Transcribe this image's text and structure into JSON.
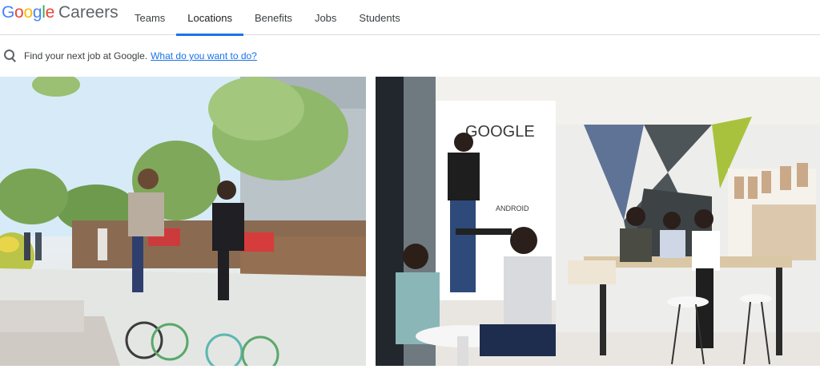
{
  "header": {
    "logo_letters": [
      {
        "char": "G",
        "color": "#4285F4"
      },
      {
        "char": "o",
        "color": "#EA4335"
      },
      {
        "char": "o",
        "color": "#FBBC05"
      },
      {
        "char": "g",
        "color": "#4285F4"
      },
      {
        "char": "l",
        "color": "#34A853"
      },
      {
        "char": "e",
        "color": "#EA4335"
      }
    ],
    "logo_suffix": "Careers",
    "nav": [
      {
        "label": "Teams",
        "active": false
      },
      {
        "label": "Locations",
        "active": true
      },
      {
        "label": "Benefits",
        "active": false
      },
      {
        "label": "Jobs",
        "active": false
      },
      {
        "label": "Students",
        "active": false
      }
    ],
    "accent_color": "#1a73e8"
  },
  "search": {
    "icon": "search-icon",
    "prompt": "Find your next job at Google.",
    "link_text": "What do you want to do?"
  },
  "photos": {
    "left_icon": "campus-cyclists-photo",
    "right_icon": "office-collaboration-photo",
    "whiteboard_text": "GOOGLE",
    "whiteboard_subtext": "ANDROID"
  }
}
